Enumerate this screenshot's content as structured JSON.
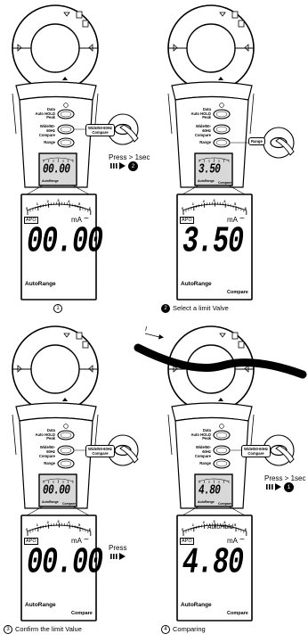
{
  "panels": [
    {
      "buttons": [
        "Data\nAuto HOLD\nPeak",
        "Wide/50-60Hz\nCompare",
        "Range"
      ],
      "callout": "Wide/50-60Hz\nCompare",
      "press_text": "Press > 1sec",
      "next_step": "2",
      "mini_display": {
        "value": "00.00",
        "mode": "AutoRange",
        "compare": ""
      },
      "large_display": {
        "apo": "APO",
        "unit": "mA",
        "ac": "~",
        "value": "00.00",
        "mode": "AutoRange",
        "compare": ""
      },
      "caption_number": "1",
      "caption_text": ""
    },
    {
      "buttons": [
        "Data\nAuto HOLD\nPeak",
        "Wide/50-60Hz\nCompare",
        "Range"
      ],
      "callout": "Range",
      "press_text": "",
      "next_step": "",
      "mini_display": {
        "value": "3.50",
        "mode": "AutoRange",
        "compare": "Compare"
      },
      "large_display": {
        "apo": "APO",
        "unit": "mA",
        "ac": "~",
        "value": "3.50",
        "mode": "AutoRange",
        "compare": "Compare"
      },
      "caption_number": "2",
      "caption_text": "Select a limit Valve"
    },
    {
      "buttons": [
        "Data\nAuto HOLD\nPeak",
        "Wide/50-60Hz\nCompare",
        "Range"
      ],
      "callout": "Wide/50-60Hz\nCompare",
      "press_text": "Press",
      "next_step": "",
      "mini_display": {
        "value": "00.00",
        "mode": "AutoRange",
        "compare": "Compare"
      },
      "large_display": {
        "apo": "APO",
        "unit": "mA",
        "ac": "~",
        "value": "00.00",
        "mode": "AutoRange",
        "compare": "Compare"
      },
      "caption_number": "3",
      "caption_text": "Confirm the limit Value"
    },
    {
      "buttons": [
        "Data\nAuto HOLD\nPeak",
        "Wide/50-60Hz\nCompare",
        "Range"
      ],
      "callout": "Wide/50-60Hz\nCompare",
      "press_text": "Press > 1sec",
      "next_step": "1",
      "mini_display": {
        "value": "4.80",
        "mode": "AutoRange",
        "compare": "Compare"
      },
      "large_display": {
        "apo": "APO",
        "unit": "mA",
        "ac": "~",
        "value": "4.80",
        "mode": "AutoRange",
        "compare": "Compare",
        "hold": "AutoHold"
      },
      "caption_number": "4",
      "caption_text": "Comparing"
    }
  ],
  "scale_ticks": [
    "0",
    "1",
    "2",
    "3",
    "4",
    "5",
    "6"
  ],
  "current_arrow": "I",
  "colors": {
    "ink": "#000000",
    "lcd": "#d8d8d8",
    "paper": "#ffffff"
  }
}
